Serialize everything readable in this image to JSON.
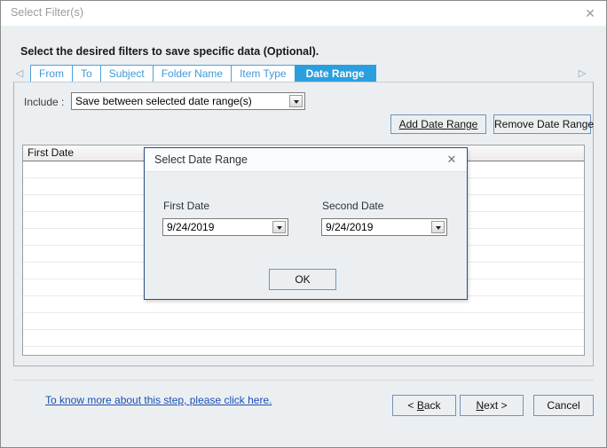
{
  "window": {
    "title": "Select Filter(s)",
    "close_icon": "close-icon",
    "heading": "Select the desired filters to save specific data (Optional)."
  },
  "tabstrip": {
    "scroll_left_icon": "◁",
    "scroll_right_icon": "▷",
    "tabs": [
      {
        "label": "From",
        "active": false
      },
      {
        "label": "To",
        "active": false
      },
      {
        "label": "Subject",
        "active": false
      },
      {
        "label": "Folder Name",
        "active": false
      },
      {
        "label": "Item Type",
        "active": false
      },
      {
        "label": "Date Range",
        "active": true
      }
    ],
    "active_tab": "Date Range"
  },
  "panel": {
    "include_label": "Include :",
    "include_value": "Save between selected date range(s)",
    "add_button": "Add Date Range",
    "remove_button": "Remove Date Range",
    "list": {
      "columns": [
        "First Date"
      ],
      "rows": [],
      "row_count": 12
    }
  },
  "footer": {
    "help_link": "To know more about this step, please click here.",
    "back_button": "< Back",
    "next_button": "Next >",
    "cancel_button": "Cancel"
  },
  "modal": {
    "title": "Select Date Range",
    "close_icon": "close-icon",
    "first_date_label": "First Date",
    "first_date_value": "9/24/2019",
    "second_date_label": "Second Date",
    "second_date_value": "9/24/2019",
    "ok_button": "OK"
  },
  "colors": {
    "accent": "#2a9fe0",
    "tab_text": "#3d9bd8",
    "window_bg": "#eceff1",
    "link": "#1a4fb4",
    "modal_border": "#2b4f7e"
  }
}
